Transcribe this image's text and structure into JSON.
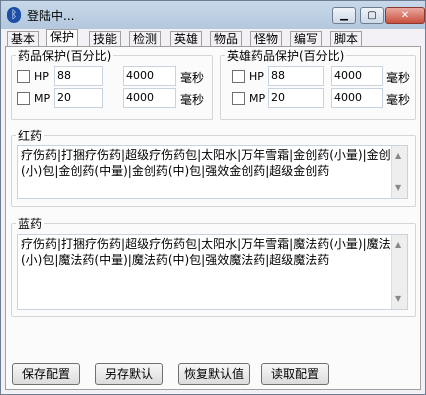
{
  "window": {
    "title": "登陆中..."
  },
  "controls": {
    "minimize": "▁",
    "maximize": "▢",
    "close": "✕"
  },
  "tabs": [
    {
      "label": "基本"
    },
    {
      "label": "保护"
    },
    {
      "label": "技能"
    },
    {
      "label": "检测"
    },
    {
      "label": "英雄"
    },
    {
      "label": "物品"
    },
    {
      "label": "怪物"
    },
    {
      "label": "编写"
    },
    {
      "label": "脚本"
    }
  ],
  "drug_protect": {
    "legend": "药品保护(百分比)",
    "hp": {
      "label": "HP",
      "percent": "88",
      "ms": "4000",
      "unit": "毫秒"
    },
    "mp": {
      "label": "MP",
      "percent": "20",
      "ms": "4000",
      "unit": "毫秒"
    }
  },
  "hero_protect": {
    "legend": "英雄药品保护(百分比)",
    "hp": {
      "label": "HP",
      "percent": "88",
      "ms": "4000",
      "unit": "毫秒"
    },
    "mp": {
      "label": "MP",
      "percent": "20",
      "ms": "4000",
      "unit": "毫秒"
    }
  },
  "red": {
    "legend": "红药",
    "text": "疗伤药|打捆疗伤药|超级疗伤药包|太阳水|万年雪霜|金创药(小量)|金创药(小)包|金创药(中量)|金创药(中)包|强效金创药|超级金创药"
  },
  "blue": {
    "legend": "蓝药",
    "text": "疗伤药|打捆疗伤药|超级疗伤药包|太阳水|万年雪霜|魔法药(小量)|魔法药(小)包|魔法药(中量)|魔法药(中)包|强效魔法药|超级魔法药"
  },
  "buttons": {
    "save": "保存配置",
    "save_default": "另存默认",
    "restore_default": "恢复默认值",
    "read": "读取配置"
  },
  "icons": {
    "app": "bluetooth-icon"
  }
}
